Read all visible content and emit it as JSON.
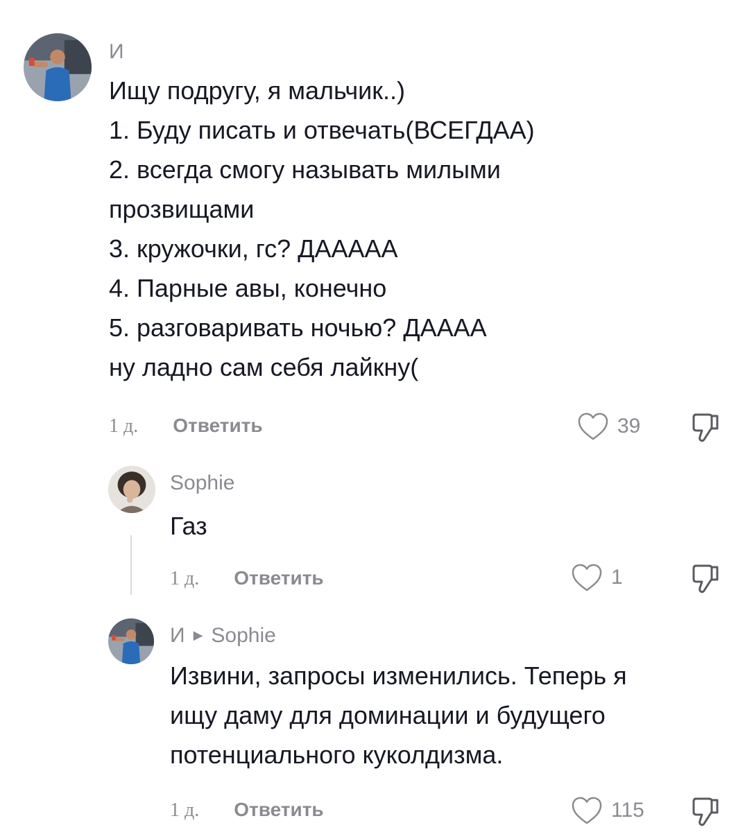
{
  "comments": [
    {
      "author": "И",
      "lines": [
        "Ищу подругу, я мальчик..)",
        "1. Буду писать и отвечать(ВСЕГДАА)",
        "2. всегда смогу называть милыми",
        "прозвищами",
        "3. кружочки, гс? ДААААА",
        "4. Парные авы, конечно",
        "5. разговаривать ночью? ДАААА",
        "ну ладно сам себя лайкну("
      ],
      "time": "1 д.",
      "reply_label": "Ответить",
      "likes": "39"
    },
    {
      "author": "Sophie",
      "lines": [
        "Газ"
      ],
      "time": "1 д.",
      "reply_label": "Ответить",
      "likes": "1"
    },
    {
      "author": "И",
      "reply_to": "Sophie",
      "lines": [
        "Извини, запросы изменились. Теперь я",
        "ищу даму для доминации и будущего",
        "потенциального куколдизма."
      ],
      "time": "1 д.",
      "reply_label": "Ответить",
      "likes": "115"
    }
  ],
  "icons": {
    "like": "heart-outline-icon",
    "dislike": "thumbs-down-icon",
    "reply_arrow": "triangle-right-icon"
  },
  "colors": {
    "text": "#161823",
    "muted": "#8a8b91",
    "thread_line": "#d8d9dc"
  }
}
